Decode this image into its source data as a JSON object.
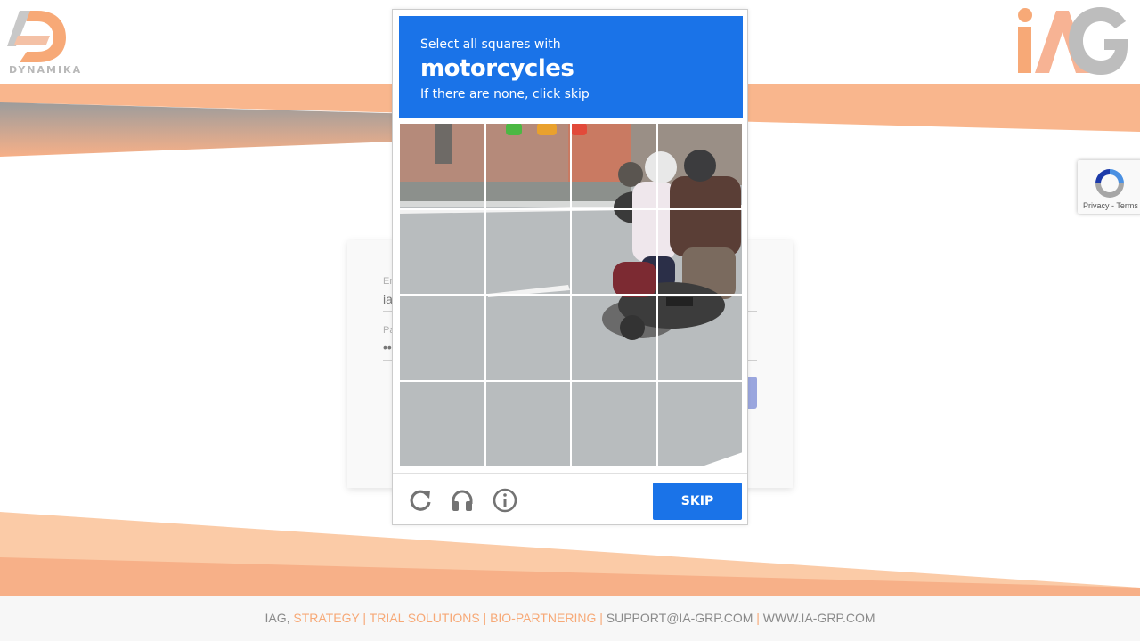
{
  "captcha": {
    "instruction_line1": "Select all squares with",
    "target": "motorcycles",
    "instruction_line3": "If there are none, click skip",
    "skip_label": "SKIP",
    "icons": [
      "reload-icon",
      "audio-icon",
      "info-icon"
    ],
    "accent_color": "#1a73e8"
  },
  "recaptcha_badge": {
    "text": "Privacy - Terms"
  },
  "login": {
    "email_label": "Er",
    "email_value": "ia",
    "password_label": "Pa",
    "password_value": "••"
  },
  "brand": {
    "left_logo_text": "DYNAMIKA",
    "accent_color": "#f7a977"
  },
  "footer": {
    "company": "IAG,",
    "services": "STRATEGY | TRIAL SOLUTIONS | BIO-PARTNERING |",
    "email": "SUPPORT@IA-GRP.COM",
    "separator": "|",
    "website": "WWW.IA-GRP.COM"
  }
}
